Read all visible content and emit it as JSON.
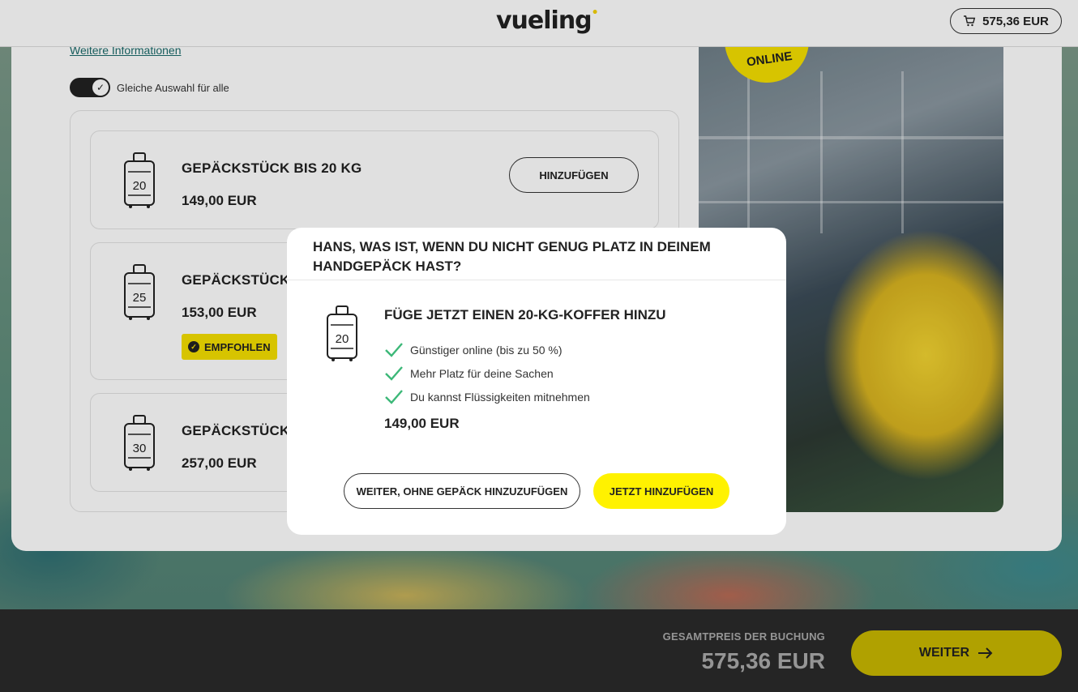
{
  "header": {
    "logo": "vueling",
    "cart_total": "575,36 EUR"
  },
  "page": {
    "more_info_link": "Weitere Informationen",
    "toggle_label": "Gleiche Auswahl für alle",
    "toggle_on": true,
    "bags": [
      {
        "icon_number": "20",
        "title": "GEPÄCKSTÜCK BIS 20 KG",
        "price": "149,00 EUR",
        "button": "HINZUFÜGEN"
      },
      {
        "icon_number": "25",
        "title": "GEPÄCKSTÜCK BI",
        "price": "153,00 EUR",
        "badge": "EMPFOHLEN"
      },
      {
        "icon_number": "30",
        "title": "GEPÄCKSTÜCK BI",
        "price": "257,00 EUR"
      }
    ],
    "photo_badge": "ONLINE"
  },
  "modal": {
    "title": "HANS, WAS IST, WENN DU NICHT GENUG PLATZ IN DEINEM HANDGEPÄCK HAST?",
    "icon_number": "20",
    "subtitle": "FÜGE JETZT EINEN 20-KG-KOFFER HINZU",
    "benefits": [
      "Günstiger online (bis zu 50 %)",
      "Mehr Platz für deine Sachen",
      "Du kannst Flüssigkeiten mitnehmen"
    ],
    "price": "149,00 EUR",
    "secondary_button": "WEITER, OHNE GEPÄCK HINZUZUFÜGEN",
    "primary_button": "JETZT HINZUFÜGEN"
  },
  "footer": {
    "total_label": "GESAMTPREIS DER BUCHUNG",
    "total_value": "575,36 EUR",
    "next_button": "WEITER"
  },
  "colors": {
    "brand_yellow": "#fff200",
    "dark": "#222222",
    "check_green": "#3cb878"
  }
}
